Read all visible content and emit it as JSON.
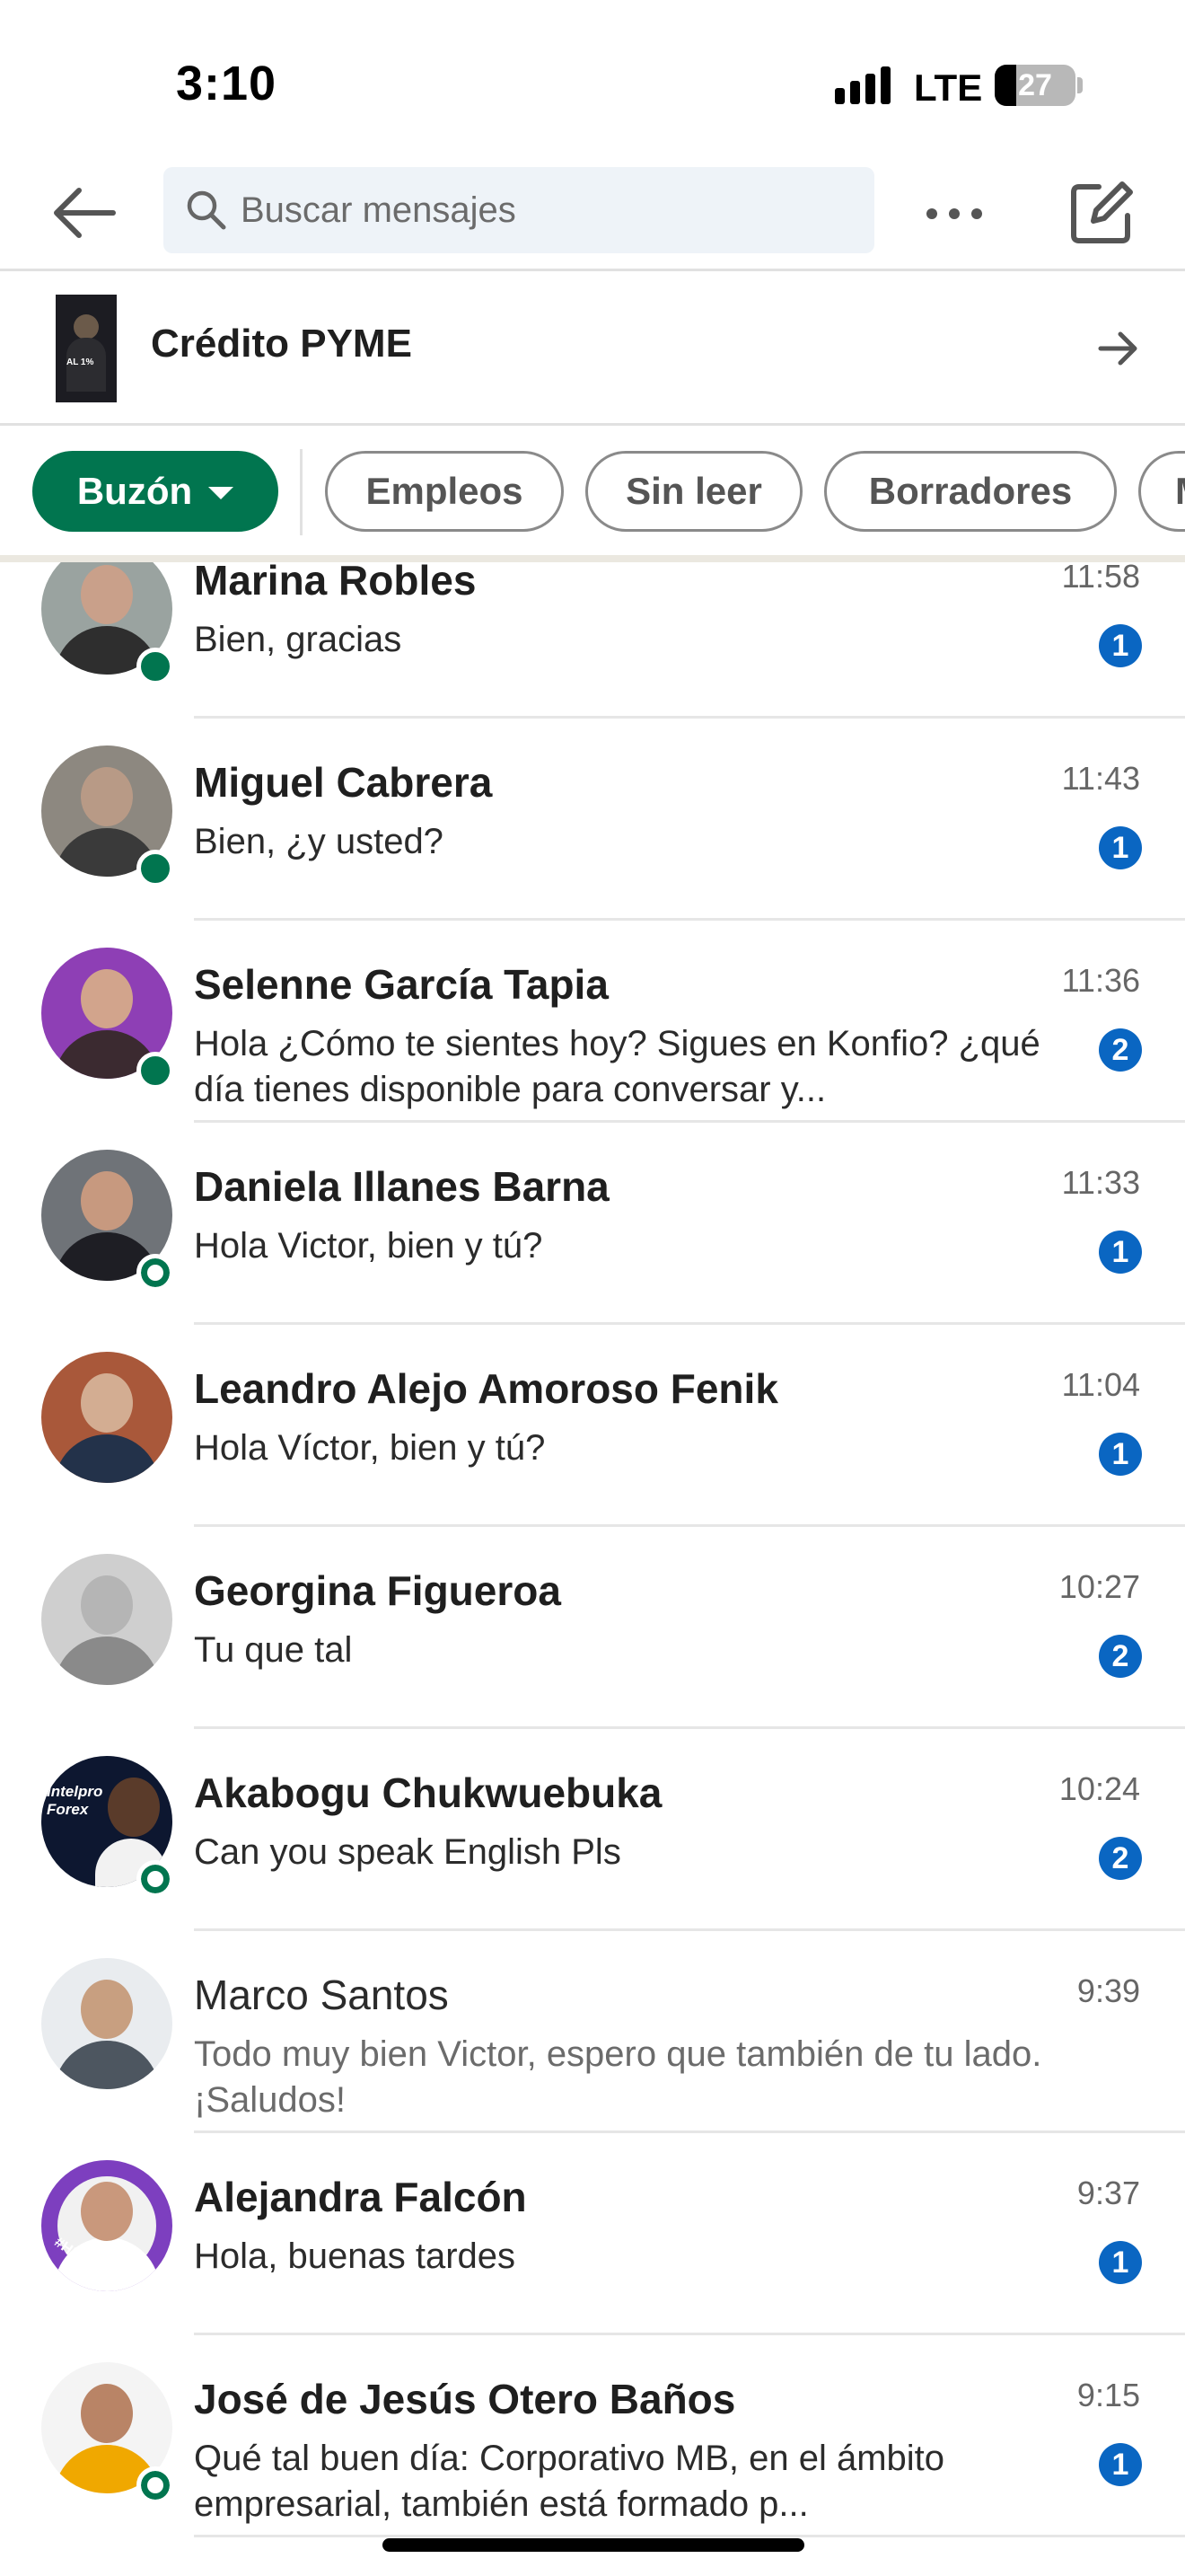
{
  "status_bar": {
    "time": "3:10",
    "network": "LTE",
    "battery": "27",
    "battery_level": 0.27
  },
  "header": {
    "search": {
      "placeholder": "Buscar mensajes"
    },
    "icons": {
      "back": "back-arrow-icon",
      "search": "search-icon",
      "more": "more-icon",
      "compose": "compose-icon"
    }
  },
  "promo": {
    "title": "Crédito PYME",
    "thumb_text": "AL 1%"
  },
  "filters": {
    "chips": [
      "Buzón",
      "Empleos",
      "Sin leer",
      "Borradores",
      "M"
    ]
  },
  "colors": {
    "accent_green": "#01754f",
    "badge_blue": "#0a66c2",
    "search_bg": "#eef3f8"
  },
  "conversations": [
    {
      "name": "Marina Robles",
      "snippet": "Bien, gracias",
      "time": "11:58",
      "unread": "1",
      "presence": "online"
    },
    {
      "name": "Miguel Cabrera",
      "snippet": "Bien, ¿y usted?",
      "time": "11:43",
      "unread": "1",
      "presence": "online"
    },
    {
      "name": "Selenne García Tapia",
      "snippet": "Hola ¿Cómo te sientes hoy? Sigues en Konfio? ¿qué día tienes disponible para conversar y...",
      "time": "11:36",
      "unread": "2",
      "presence": "online"
    },
    {
      "name": "Daniela Illanes Barna",
      "snippet": "Hola Victor, bien y tú?",
      "time": "11:33",
      "unread": "1",
      "presence": "recent"
    },
    {
      "name": "Leandro Alejo Amoroso Fenik",
      "snippet": "Hola Víctor, bien y tú?",
      "time": "11:04",
      "unread": "1",
      "presence": "none"
    },
    {
      "name": "Georgina Figueroa",
      "snippet": "Tu que tal",
      "time": "10:27",
      "unread": "2",
      "presence": "none"
    },
    {
      "name": "Akabogu Chukwuebuka",
      "snippet": "Can you speak English Pls",
      "time": "10:24",
      "unread": "2",
      "presence": "recent",
      "avatar_text": "Intelpro Forex"
    },
    {
      "name": "Marco Santos",
      "snippet": "Todo muy bien Victor, espero que también de tu lado. ¡Saludos!",
      "time": "9:39",
      "unread": "",
      "presence": "none"
    },
    {
      "name": "Alejandra Falcón",
      "snippet": "Hola, buenas tardes",
      "time": "9:37",
      "unread": "1",
      "presence": "none",
      "avatar_text": "#HIRING"
    },
    {
      "name": "José de Jesús Otero Baños",
      "snippet": "Qué tal buen día: Corporativo MB, en el ámbito empresarial, también está formado p...",
      "time": "9:15",
      "unread": "1",
      "presence": "recent"
    }
  ]
}
